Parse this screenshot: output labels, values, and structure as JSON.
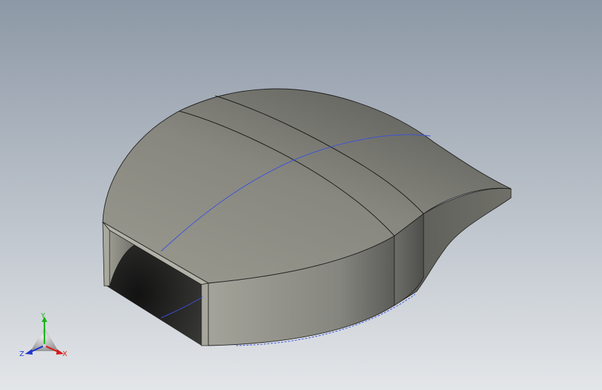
{
  "colors": {
    "background_top": "#8d98a6",
    "background_bottom": "#e3e6e9",
    "surface_light": "#a2a298",
    "surface_mid": "#898981",
    "surface_dark": "#5f5f5a",
    "edge": "#1b1b1b",
    "sketch_line": "#3b52d8",
    "axis_x": "#d61c1c",
    "axis_y": "#19b31a",
    "axis_z": "#2136c9"
  },
  "triad": {
    "x_label": "X",
    "y_label": "Y",
    "z_label": "Z",
    "x_icon": "axis-x-arrow-icon",
    "y_icon": "axis-y-arrow-icon",
    "z_icon": "axis-z-arrow-icon"
  }
}
